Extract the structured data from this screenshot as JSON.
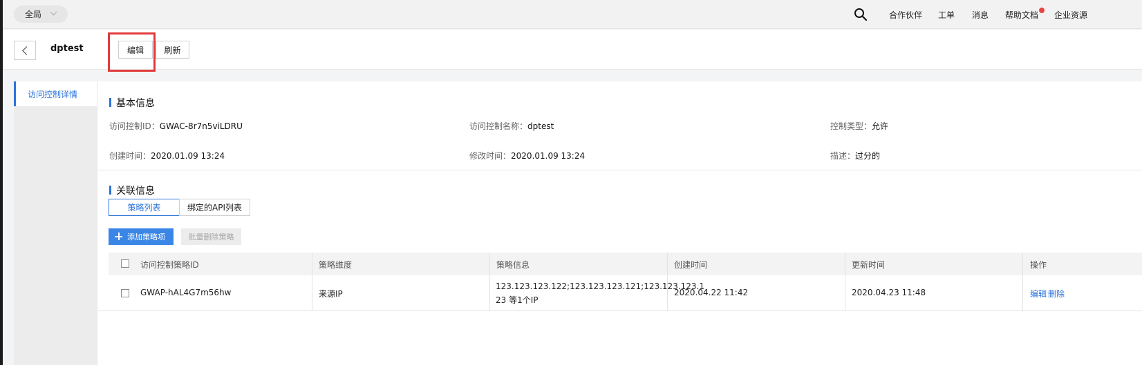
{
  "topbar": {
    "region": "全局",
    "links": [
      "合作伙伴",
      "工单",
      "消息",
      "帮助文档",
      "企业资源"
    ]
  },
  "header": {
    "title": "dptest",
    "edit_label": "编辑",
    "refresh_label": "刷新"
  },
  "sidebar": {
    "items": [
      {
        "label": "访问控制详情"
      }
    ]
  },
  "basic": {
    "title": "基本信息",
    "fields": [
      {
        "key": "访问控制ID：",
        "value": "GWAC-8r7n5viLDRU"
      },
      {
        "key": "访问控制名称：",
        "value": "dptest"
      },
      {
        "key": "控制类型：",
        "value": "允许"
      },
      {
        "key": "创建时间：",
        "value": "2020.01.09 13:24"
      },
      {
        "key": "修改时间：",
        "value": "2020.01.09 13:24"
      },
      {
        "key": "描述：",
        "value": "过分的"
      }
    ]
  },
  "related": {
    "title": "关联信息",
    "tabs": [
      "策略列表",
      "绑定的API列表"
    ],
    "add_label": "添加策略项",
    "batch_delete_label": "批量删除策略",
    "columns": [
      "访问控制策略ID",
      "策略维度",
      "策略信息",
      "创建时间",
      "更新时间",
      "操作"
    ],
    "rows": [
      {
        "id": "GWAP-hAL4G7m56hw",
        "dimension": "来源IP",
        "info_line1": "123.123.123.122;123.123.123.121;123.123.123.1",
        "info_line2": "23 等1个IP",
        "created": "2020.04.22 11:42",
        "updated": "2020.04.23 11:48",
        "actions": [
          "编辑",
          "删除"
        ]
      }
    ]
  },
  "colors": {
    "accent": "#2b73da",
    "highlight": "#e23a3a",
    "badge": "#e54545"
  }
}
